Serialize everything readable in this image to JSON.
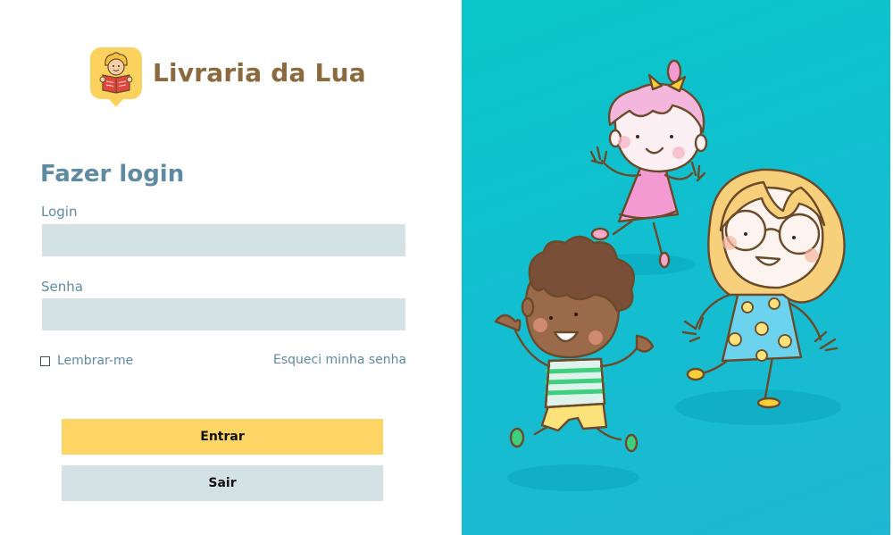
{
  "brand": {
    "name": "Livraria da Lua",
    "logo_icon": "kid-reading-book-icon"
  },
  "form": {
    "title": "Fazer login",
    "login_label": "Login",
    "login_value": "",
    "password_label": "Senha",
    "password_value": "",
    "remember_label": "Lembrar-me",
    "remember_checked": false,
    "forgot_link": "Esqueci minha senha",
    "submit_label": "Entrar",
    "exit_label": "Sair"
  },
  "illustration": {
    "icon": "happy-children-illustration"
  },
  "colors": {
    "accent": "#fdd564",
    "field_bg": "#d4e2e5",
    "text_blue": "#5e8aa2",
    "brand_brown": "#8b6a3e",
    "panel_teal": "#12bfd0"
  }
}
